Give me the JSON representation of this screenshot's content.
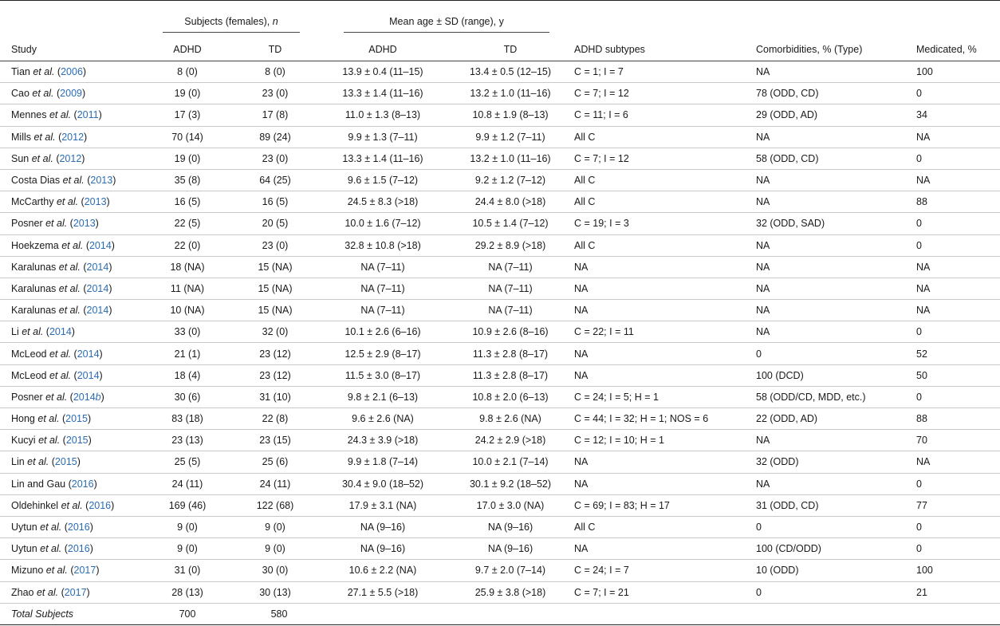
{
  "header": {
    "group_subjects": "Subjects (females),",
    "group_subjects_italic": "n",
    "group_age": "Mean age ± SD (range), y",
    "cols": {
      "study": "Study",
      "adhd_n": "ADHD",
      "td_n": "TD",
      "adhd_age": "ADHD",
      "td_age": "TD",
      "subtypes": "ADHD subtypes",
      "comorbid": "Comorbidities, % (Type)",
      "medicated": "Medicated, %"
    }
  },
  "rows": [
    {
      "a": "Tian",
      "i": "et al.",
      "y": "2006",
      "s": "",
      "n1": "8 (0)",
      "n2": "8 (0)",
      "g1": "13.9 ± 0.4 (11–15)",
      "g2": "13.4 ± 0.5 (12–15)",
      "st": "C = 1; I = 7",
      "cm": "NA",
      "md": "100"
    },
    {
      "a": "Cao",
      "i": "et al.",
      "y": "2009",
      "s": "",
      "n1": "19 (0)",
      "n2": "23 (0)",
      "g1": "13.3 ± 1.4 (11–16)",
      "g2": "13.2 ± 1.0 (11–16)",
      "st": "C = 7; I = 12",
      "cm": "78 (ODD, CD)",
      "md": "0"
    },
    {
      "a": "Mennes",
      "i": "et al.",
      "y": "2011",
      "s": "",
      "n1": "17 (3)",
      "n2": "17 (8)",
      "g1": "11.0 ± 1.3 (8–13)",
      "g2": "10.8 ± 1.9 (8–13)",
      "st": "C = 11; I = 6",
      "cm": "29 (ODD, AD)",
      "md": "34"
    },
    {
      "a": "Mills",
      "i": "et al.",
      "y": "2012",
      "s": "",
      "n1": "70 (14)",
      "n2": "89 (24)",
      "g1": "9.9 ± 1.3 (7–11)",
      "g2": "9.9 ± 1.2 (7–11)",
      "st": "All C",
      "cm": "NA",
      "md": "NA"
    },
    {
      "a": "Sun",
      "i": "et al.",
      "y": "2012",
      "s": "",
      "n1": "19 (0)",
      "n2": "23 (0)",
      "g1": "13.3 ± 1.4 (11–16)",
      "g2": "13.2 ± 1.0 (11–16)",
      "st": "C = 7; I = 12",
      "cm": "58 (ODD, CD)",
      "md": "0"
    },
    {
      "a": "Costa Dias",
      "i": "et al.",
      "y": "2013",
      "s": "",
      "n1": "35 (8)",
      "n2": "64 (25)",
      "g1": "9.6 ± 1.5 (7–12)",
      "g2": "9.2 ± 1.2 (7–12)",
      "st": "All C",
      "cm": "NA",
      "md": "NA"
    },
    {
      "a": "McCarthy",
      "i": "et al.",
      "y": "2013",
      "s": "",
      "n1": "16 (5)",
      "n2": "16 (5)",
      "g1": "24.5 ± 8.3 (>18)",
      "g2": "24.4 ± 8.0 (>18)",
      "st": "All C",
      "cm": "NA",
      "md": "88"
    },
    {
      "a": "Posner",
      "i": "et al.",
      "y": "2013",
      "s": "",
      "n1": "22 (5)",
      "n2": "20 (5)",
      "g1": "10.0 ± 1.6 (7–12)",
      "g2": "10.5 ± 1.4 (7–12)",
      "st": "C = 19; I = 3",
      "cm": "32 (ODD, SAD)",
      "md": "0"
    },
    {
      "a": "Hoekzema",
      "i": "et al.",
      "y": "2014",
      "s": "",
      "n1": "22 (0)",
      "n2": "23 (0)",
      "g1": "32.8 ± 10.8 (>18)",
      "g2": "29.2 ± 8.9 (>18)",
      "st": "All C",
      "cm": "NA",
      "md": "0"
    },
    {
      "a": "Karalunas",
      "i": "et al.",
      "y": "2014",
      "s": "",
      "n1": "18 (NA)",
      "n2": "15 (NA)",
      "g1": "NA (7–11)",
      "g2": "NA (7–11)",
      "st": "NA",
      "cm": "NA",
      "md": "NA"
    },
    {
      "a": "Karalunas",
      "i": "et al.",
      "y": "2014",
      "s": "",
      "n1": "11 (NA)",
      "n2": "15 (NA)",
      "g1": "NA (7–11)",
      "g2": "NA (7–11)",
      "st": "NA",
      "cm": "NA",
      "md": "NA"
    },
    {
      "a": "Karalunas",
      "i": "et al.",
      "y": "2014",
      "s": "",
      "n1": "10 (NA)",
      "n2": "15 (NA)",
      "g1": "NA (7–11)",
      "g2": "NA (7–11)",
      "st": "NA",
      "cm": "NA",
      "md": "NA"
    },
    {
      "a": "Li",
      "i": "et al.",
      "y": "2014",
      "s": "",
      "n1": "33 (0)",
      "n2": "32 (0)",
      "g1": "10.1 ± 2.6 (6–16)",
      "g2": "10.9 ± 2.6 (8–16)",
      "st": "C = 22; I = 11",
      "cm": "NA",
      "md": "0"
    },
    {
      "a": "McLeod",
      "i": "et al.",
      "y": "2014",
      "s": "",
      "n1": "21 (1)",
      "n2": "23 (12)",
      "g1": "12.5 ± 2.9 (8–17)",
      "g2": "11.3 ± 2.8 (8–17)",
      "st": "NA",
      "cm": "0",
      "md": "52"
    },
    {
      "a": "McLeod",
      "i": "et al.",
      "y": "2014",
      "s": "",
      "n1": "18 (4)",
      "n2": "23 (12)",
      "g1": "11.5 ± 3.0 (8–17)",
      "g2": "11.3 ± 2.8 (8–17)",
      "st": "NA",
      "cm": "100 (DCD)",
      "md": "50"
    },
    {
      "a": "Posner",
      "i": "et al.",
      "y": "2014",
      "s": "b",
      "n1": "30 (6)",
      "n2": "31 (10)",
      "g1": "9.8 ± 2.1 (6–13)",
      "g2": "10.8 ± 2.0 (6–13)",
      "st": "C = 24; I = 5; H = 1",
      "cm": "58 (ODD/CD, MDD, etc.)",
      "md": "0"
    },
    {
      "a": "Hong",
      "i": "et al.",
      "y": "2015",
      "s": "",
      "n1": "83 (18)",
      "n2": "22 (8)",
      "g1": "9.6 ± 2.6 (NA)",
      "g2": "9.8 ± 2.6 (NA)",
      "st": "C = 44; I = 32; H = 1; NOS = 6",
      "cm": "22 (ODD, AD)",
      "md": "88"
    },
    {
      "a": "Kucyi",
      "i": "et al.",
      "y": "2015",
      "s": "",
      "n1": "23 (13)",
      "n2": "23 (15)",
      "g1": "24.3 ± 3.9 (>18)",
      "g2": "24.2 ± 2.9 (>18)",
      "st": "C = 12; I = 10; H = 1",
      "cm": "NA",
      "md": "70"
    },
    {
      "a": "Lin",
      "i": "et al.",
      "y": "2015",
      "s": "",
      "n1": "25 (5)",
      "n2": "25 (6)",
      "g1": "9.9 ± 1.8 (7–14)",
      "g2": "10.0 ± 2.1 (7–14)",
      "st": "NA",
      "cm": "32 (ODD)",
      "md": "NA"
    },
    {
      "a": "Lin and Gau",
      "i": "",
      "y": "2016",
      "s": "",
      "n1": "24 (11)",
      "n2": "24 (11)",
      "g1": "30.4 ± 9.0 (18–52)",
      "g2": "30.1 ± 9.2 (18–52)",
      "st": "NA",
      "cm": "NA",
      "md": "0"
    },
    {
      "a": "Oldehinkel",
      "i": "et al.",
      "y": "2016",
      "s": "",
      "n1": "169 (46)",
      "n2": "122 (68)",
      "g1": "17.9 ± 3.1 (NA)",
      "g2": "17.0 ± 3.0 (NA)",
      "st": "C = 69; I = 83; H = 17",
      "cm": "31 (ODD, CD)",
      "md": "77"
    },
    {
      "a": "Uytun",
      "i": "et al.",
      "y": "2016",
      "s": "",
      "n1": "9 (0)",
      "n2": "9 (0)",
      "g1": "NA (9–16)",
      "g2": "NA (9–16)",
      "st": "All C",
      "cm": "0",
      "md": "0"
    },
    {
      "a": "Uytun",
      "i": "et al.",
      "y": "2016",
      "s": "",
      "n1": "9 (0)",
      "n2": "9 (0)",
      "g1": "NA (9–16)",
      "g2": "NA (9–16)",
      "st": "NA",
      "cm": "100 (CD/ODD)",
      "md": "0"
    },
    {
      "a": "Mizuno",
      "i": "et al.",
      "y": "2017",
      "s": "",
      "n1": "31 (0)",
      "n2": "30 (0)",
      "g1": "10.6 ± 2.2 (NA)",
      "g2": "9.7 ± 2.0 (7–14)",
      "st": "C = 24; I = 7",
      "cm": "10 (ODD)",
      "md": "100"
    },
    {
      "a": "Zhao",
      "i": "et al.",
      "y": "2017",
      "s": "",
      "n1": "28 (13)",
      "n2": "30 (13)",
      "g1": "27.1 ± 5.5 (>18)",
      "g2": "25.9 ± 3.8 (>18)",
      "st": "C = 7; I = 21",
      "cm": "0",
      "md": "21"
    }
  ],
  "total": {
    "label": "Total Subjects",
    "adhd": "700",
    "td": "580"
  }
}
